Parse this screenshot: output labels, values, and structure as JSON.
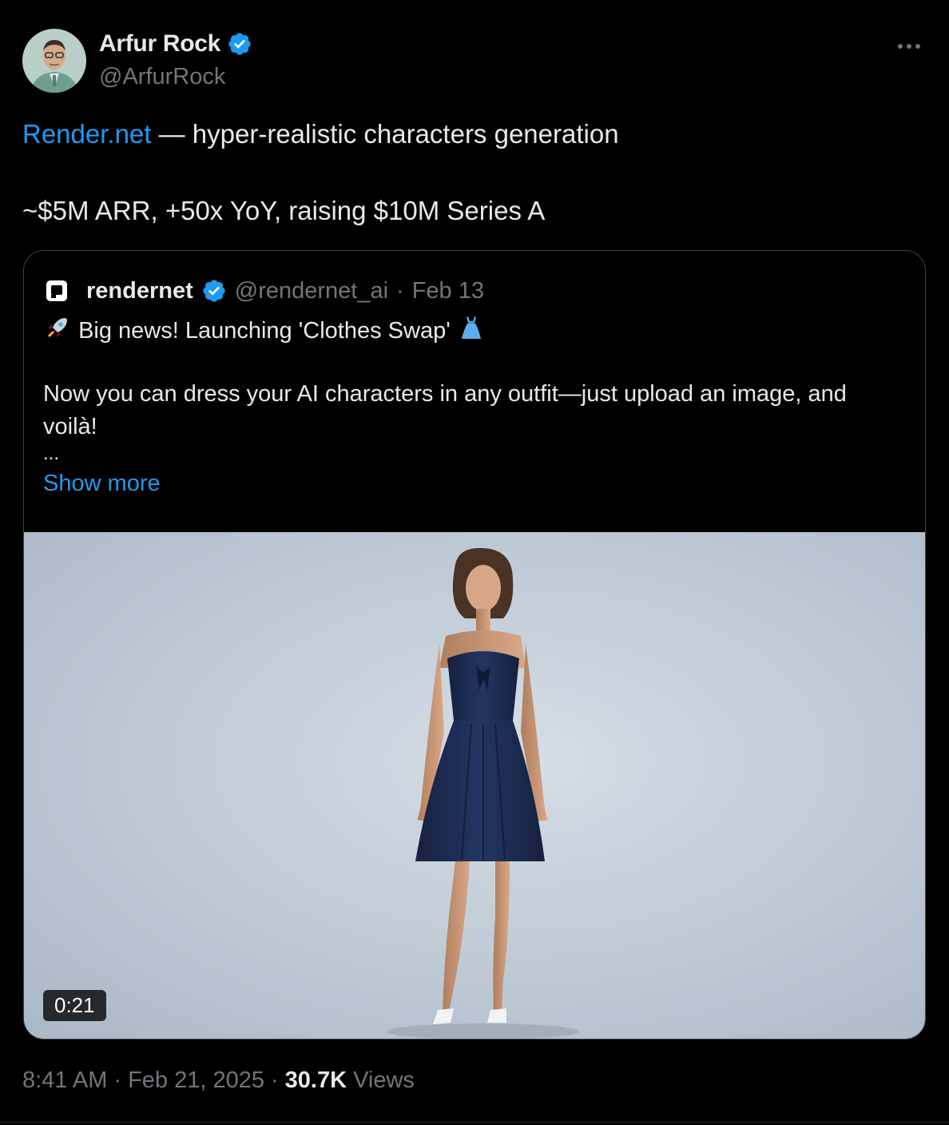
{
  "author": {
    "name": "Arfur Rock",
    "handle": "@ArfurRock"
  },
  "tweet": {
    "link_text": "Render.net",
    "line1_rest": " — hyper-realistic characters generation",
    "line2": "~$5M ARR, +50x YoY, raising $10M Series A"
  },
  "quoted": {
    "name": "rendernet",
    "handle": "@rendernet_ai",
    "separator": "·",
    "date": "Feb 13",
    "line1": "Big news! Launching 'Clothes Swap'",
    "line2": "Now you can dress your AI characters in any outfit—just upload an image, and",
    "line3": "voilà!",
    "ellipsis": "...",
    "show_more": "Show more",
    "video_duration": "0:21"
  },
  "footer": {
    "time": "8:41 AM",
    "sep1": "·",
    "date": "Feb 21, 2025",
    "sep2": "·",
    "views_count": "30.7K",
    "views_label": "Views"
  },
  "colors": {
    "background": "#000000",
    "text": "#e7e9ea",
    "muted": "#71767b",
    "accent": "#1d9bf0",
    "dress": "#1c2a4f"
  },
  "icons": [
    "avatar",
    "verified-badge-icon",
    "more-icon",
    "rendernet-logo-icon",
    "rocket-emoji-icon",
    "dress-emoji-icon",
    "video-thumbnail"
  ]
}
